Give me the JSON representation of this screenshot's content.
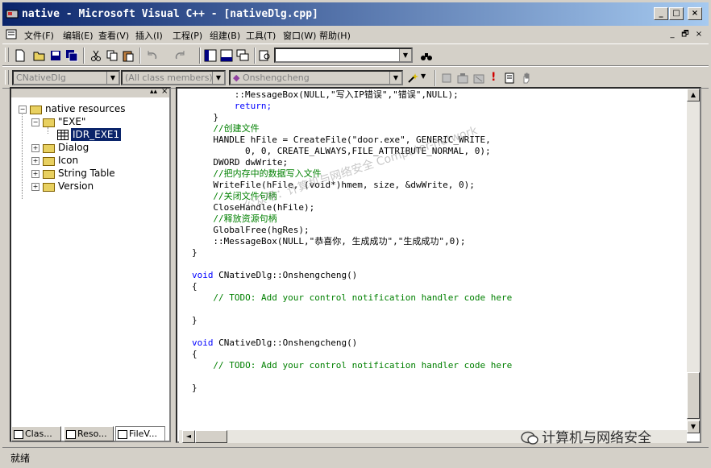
{
  "window": {
    "title": "native - Microsoft Visual C++ - [nativeDlg.cpp]",
    "controls": {
      "minimize": "_",
      "maximize": "□",
      "close": "×"
    }
  },
  "menu": {
    "items": [
      "文件(F)",
      "编辑(E)",
      "查看(V)",
      "插入(I)",
      "工程(P)",
      "组建(B)",
      "工具(T)",
      "窗口(W)",
      "帮助(H)"
    ],
    "mdi_controls": {
      "minimize": "_",
      "restore": "🗗",
      "close": "×"
    }
  },
  "toolbar2": {
    "class_combo": "CNativeDlg",
    "members_combo": "(All class members)",
    "function_combo": "Onshengcheng"
  },
  "workspace": {
    "tree": {
      "root": "native resources",
      "exe_folder": "\"EXE\"",
      "exe_item": "IDR_EXE1",
      "folders": [
        "Dialog",
        "Icon",
        "String Table",
        "Version"
      ]
    },
    "tabs": [
      "Clas...",
      "Reso...",
      "FileV..."
    ]
  },
  "editor": {
    "lines": [
      {
        "indent": 8,
        "text": "::MessageBox(NULL,\"写入IP错误\",\"错误\",NULL);",
        "type": "code"
      },
      {
        "indent": 8,
        "text": "return;",
        "type": "kw"
      },
      {
        "indent": 4,
        "text": "}",
        "type": "code"
      },
      {
        "indent": 4,
        "text": "//创建文件",
        "type": "comment"
      },
      {
        "indent": 4,
        "text": "HANDLE hFile = CreateFile(\"door.exe\", GENERIC_WRITE,",
        "type": "code"
      },
      {
        "indent": 10,
        "text": "0, 0, CREATE_ALWAYS,FILE_ATTRIBUTE_NORMAL, 0);",
        "type": "code"
      },
      {
        "indent": 4,
        "text": "DWORD dwWrite;",
        "type": "code"
      },
      {
        "indent": 4,
        "text": "//把内存中的数据写入文件",
        "type": "comment"
      },
      {
        "indent": 4,
        "text": "WriteFile(hFile, (void*)hmem, size, &dwWrite, 0);",
        "type": "code"
      },
      {
        "indent": 4,
        "text": "//关闭文件句柄",
        "type": "comment"
      },
      {
        "indent": 4,
        "text": "CloseHandle(hFile);",
        "type": "code"
      },
      {
        "indent": 4,
        "text": "//释放资源句柄",
        "type": "comment"
      },
      {
        "indent": 4,
        "text": "GlobalFree(hgRes);",
        "type": "code"
      },
      {
        "indent": 4,
        "text": "::MessageBox(NULL,\"恭喜你, 生成成功\",\"生成成功\",0);",
        "type": "code"
      },
      {
        "indent": 0,
        "text": "}",
        "type": "code"
      },
      {
        "indent": 0,
        "text": "",
        "type": "code"
      },
      {
        "indent": 0,
        "text": "void CNativeDlg::Onshengcheng()",
        "type": "void"
      },
      {
        "indent": 0,
        "text": "{",
        "type": "code"
      },
      {
        "indent": 4,
        "text": "// TODO: Add your control notification handler code here",
        "type": "comment"
      },
      {
        "indent": 0,
        "text": "",
        "type": "code"
      },
      {
        "indent": 0,
        "text": "}",
        "type": "code"
      },
      {
        "indent": 0,
        "text": "",
        "type": "code"
      },
      {
        "indent": 0,
        "text": "void CNativeDlg::Onshengcheng()",
        "type": "void"
      },
      {
        "indent": 0,
        "text": "{",
        "type": "code"
      },
      {
        "indent": 4,
        "text": "// TODO: Add your control notification handler code here",
        "type": "comment"
      },
      {
        "indent": 0,
        "text": "",
        "type": "code"
      },
      {
        "indent": 0,
        "text": "}",
        "type": "code"
      }
    ]
  },
  "status": {
    "text": "就绪"
  },
  "watermark": "公众号：计算机与网络安全 Computer-network",
  "brand": "计算机与网络安全"
}
